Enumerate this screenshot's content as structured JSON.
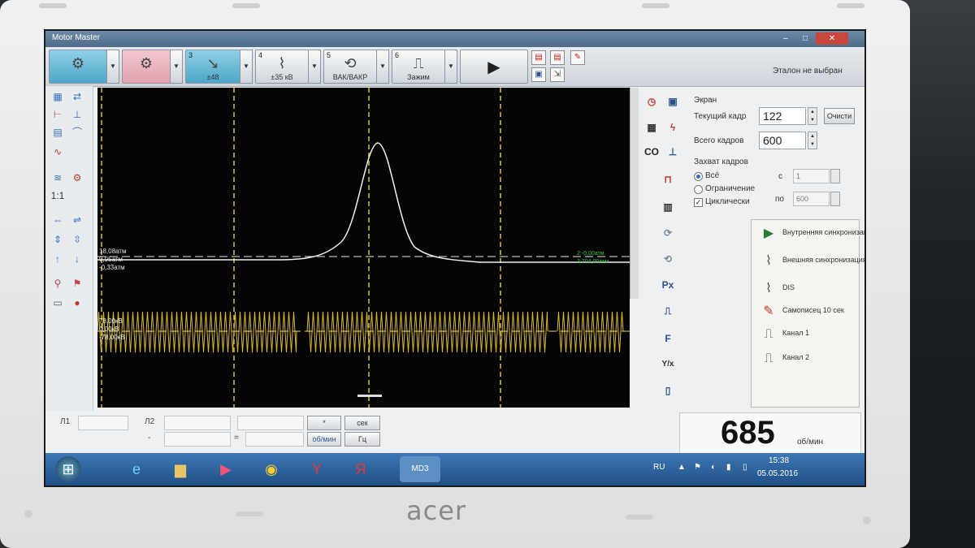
{
  "window": {
    "title": "Motor Master"
  },
  "toolbar": {
    "buttons": [
      {
        "num": "",
        "cap": ""
      },
      {
        "num": "",
        "cap": ""
      },
      {
        "num": "3",
        "cap": "±48"
      },
      {
        "num": "4",
        "cap": "±35 кВ"
      },
      {
        "num": "5",
        "cap": "ВАК/ВАКР"
      },
      {
        "num": "6",
        "cap": "Зажим"
      }
    ],
    "play_icon": "play-icon",
    "etalon": "Эталон не выбран"
  },
  "scope": {
    "ch1_labels": [
      "18,08атм",
      "0,95атм",
      "-0,33атм"
    ],
    "ch1_right_labels": [
      "2:-0,00атм",
      "3:704,00атм"
    ],
    "ch2_labels": [
      "78,00кВ",
      "0,00кВ",
      "-78,00кВ"
    ]
  },
  "panel": {
    "screen_label": "Экран",
    "current_frame_label": "Текущий кадр",
    "current_frame": "122",
    "clear_label": "Очисти",
    "total_frames_label": "Всего кадров",
    "total_frames": "600",
    "capture_label": "Захват кадров",
    "opt_all": "Всё",
    "opt_limit": "Ограничение",
    "opt_cyclic": "Циклически",
    "from_label": "с",
    "from_value": "1",
    "to_label": "по",
    "to_value": "600",
    "sync_items": [
      {
        "icon": "play-triangle-icon",
        "text": "Внутренняя синхронизация"
      },
      {
        "icon": "clamp-icon",
        "text": "Внешняя синхронизация"
      },
      {
        "icon": "dis-icon",
        "text": "DIS"
      },
      {
        "icon": "recorder-icon",
        "text": "Самописец 10 сек"
      },
      {
        "icon": "channel1-icon",
        "text": "Канал 1"
      },
      {
        "icon": "channel2-icon",
        "text": "Канал 2"
      }
    ]
  },
  "right_icons": [
    "CO",
    "Px",
    "F",
    "Y/x"
  ],
  "bottom": {
    "l1": "Л1",
    "l2": "Л2",
    "star": "*",
    "minus": "-",
    "eq": "=",
    "sec": "сек",
    "rpm_btn": "об/мин",
    "hz": "Гц",
    "rpm_value": "685",
    "rpm_unit": "об/мин"
  },
  "taskbar": {
    "lang": "RU",
    "time": "15:38",
    "date": "05.05.2016",
    "app_label": "MD3"
  },
  "brand": "acer"
}
